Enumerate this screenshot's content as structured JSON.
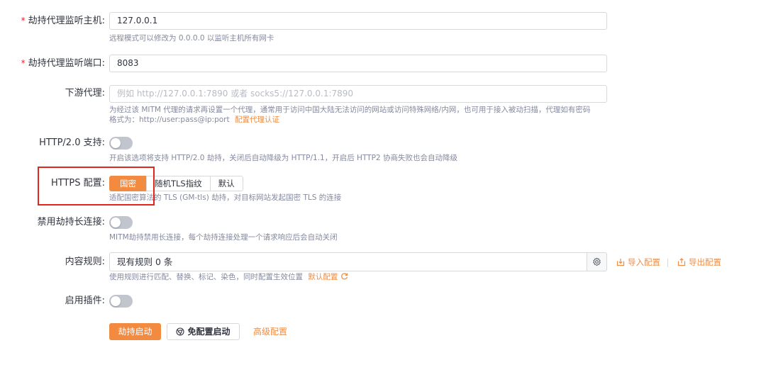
{
  "form": {
    "host": {
      "label": "劫持代理监听主机:",
      "required_mark": "*",
      "value": "127.0.0.1",
      "help": "远程模式可以修改为 0.0.0.0 以监听主机所有网卡"
    },
    "port": {
      "label": "劫持代理监听端口:",
      "required_mark": "*",
      "value": "8083"
    },
    "downstream": {
      "label": "下游代理:",
      "placeholder": "例如 http://127.0.0.1:7890 或者 socks5://127.0.0.1:7890",
      "help_line1": "为经过该 MITM 代理的请求再设置一个代理，通常用于访问中国大陆无法访问的网站或访问特殊网络/内网，也可用于接入被动扫描，代理如有密码",
      "help_line2": "格式为：http://user:pass@ip:port",
      "help_link": "配置代理认证"
    },
    "http2": {
      "label": "HTTP/2.0 支持:",
      "enabled": false,
      "help": "开启该选项将支持 HTTP/2.0 劫持，关闭后自动降级为 HTTP/1.1，开启后 HTTP2 协商失败也会自动降级"
    },
    "https": {
      "label": "HTTPS 配置:",
      "options": [
        "国密",
        "随机TLS指纹",
        "默认"
      ],
      "selected": "国密",
      "help": "适配国密算法的 TLS (GM-tls) 劫持，对目标网站发起国密 TLS 的连接"
    },
    "disable_keepalive": {
      "label": "禁用劫持长连接:",
      "enabled": false,
      "help": "MITM劫持禁用长连接，每个劫持连接处理一个请求响应后会自动关闭"
    },
    "rules": {
      "label": "内容规则:",
      "value": "现有规则 0 条",
      "import_label": "导入配置",
      "export_label": "导出配置",
      "help": "使用规则进行匹配、替换、标记、染色，同时配置生效位置",
      "help_link": "默认配置"
    },
    "plugins": {
      "label": "启用插件:",
      "enabled": false
    }
  },
  "actions": {
    "start": "劫持启动",
    "start_no_config": "免配置启动",
    "advanced": "高级配置"
  },
  "colors": {
    "accent": "#f28b3f",
    "highlight_box": "#e3261c",
    "switch_off": "#c1c5ce"
  }
}
